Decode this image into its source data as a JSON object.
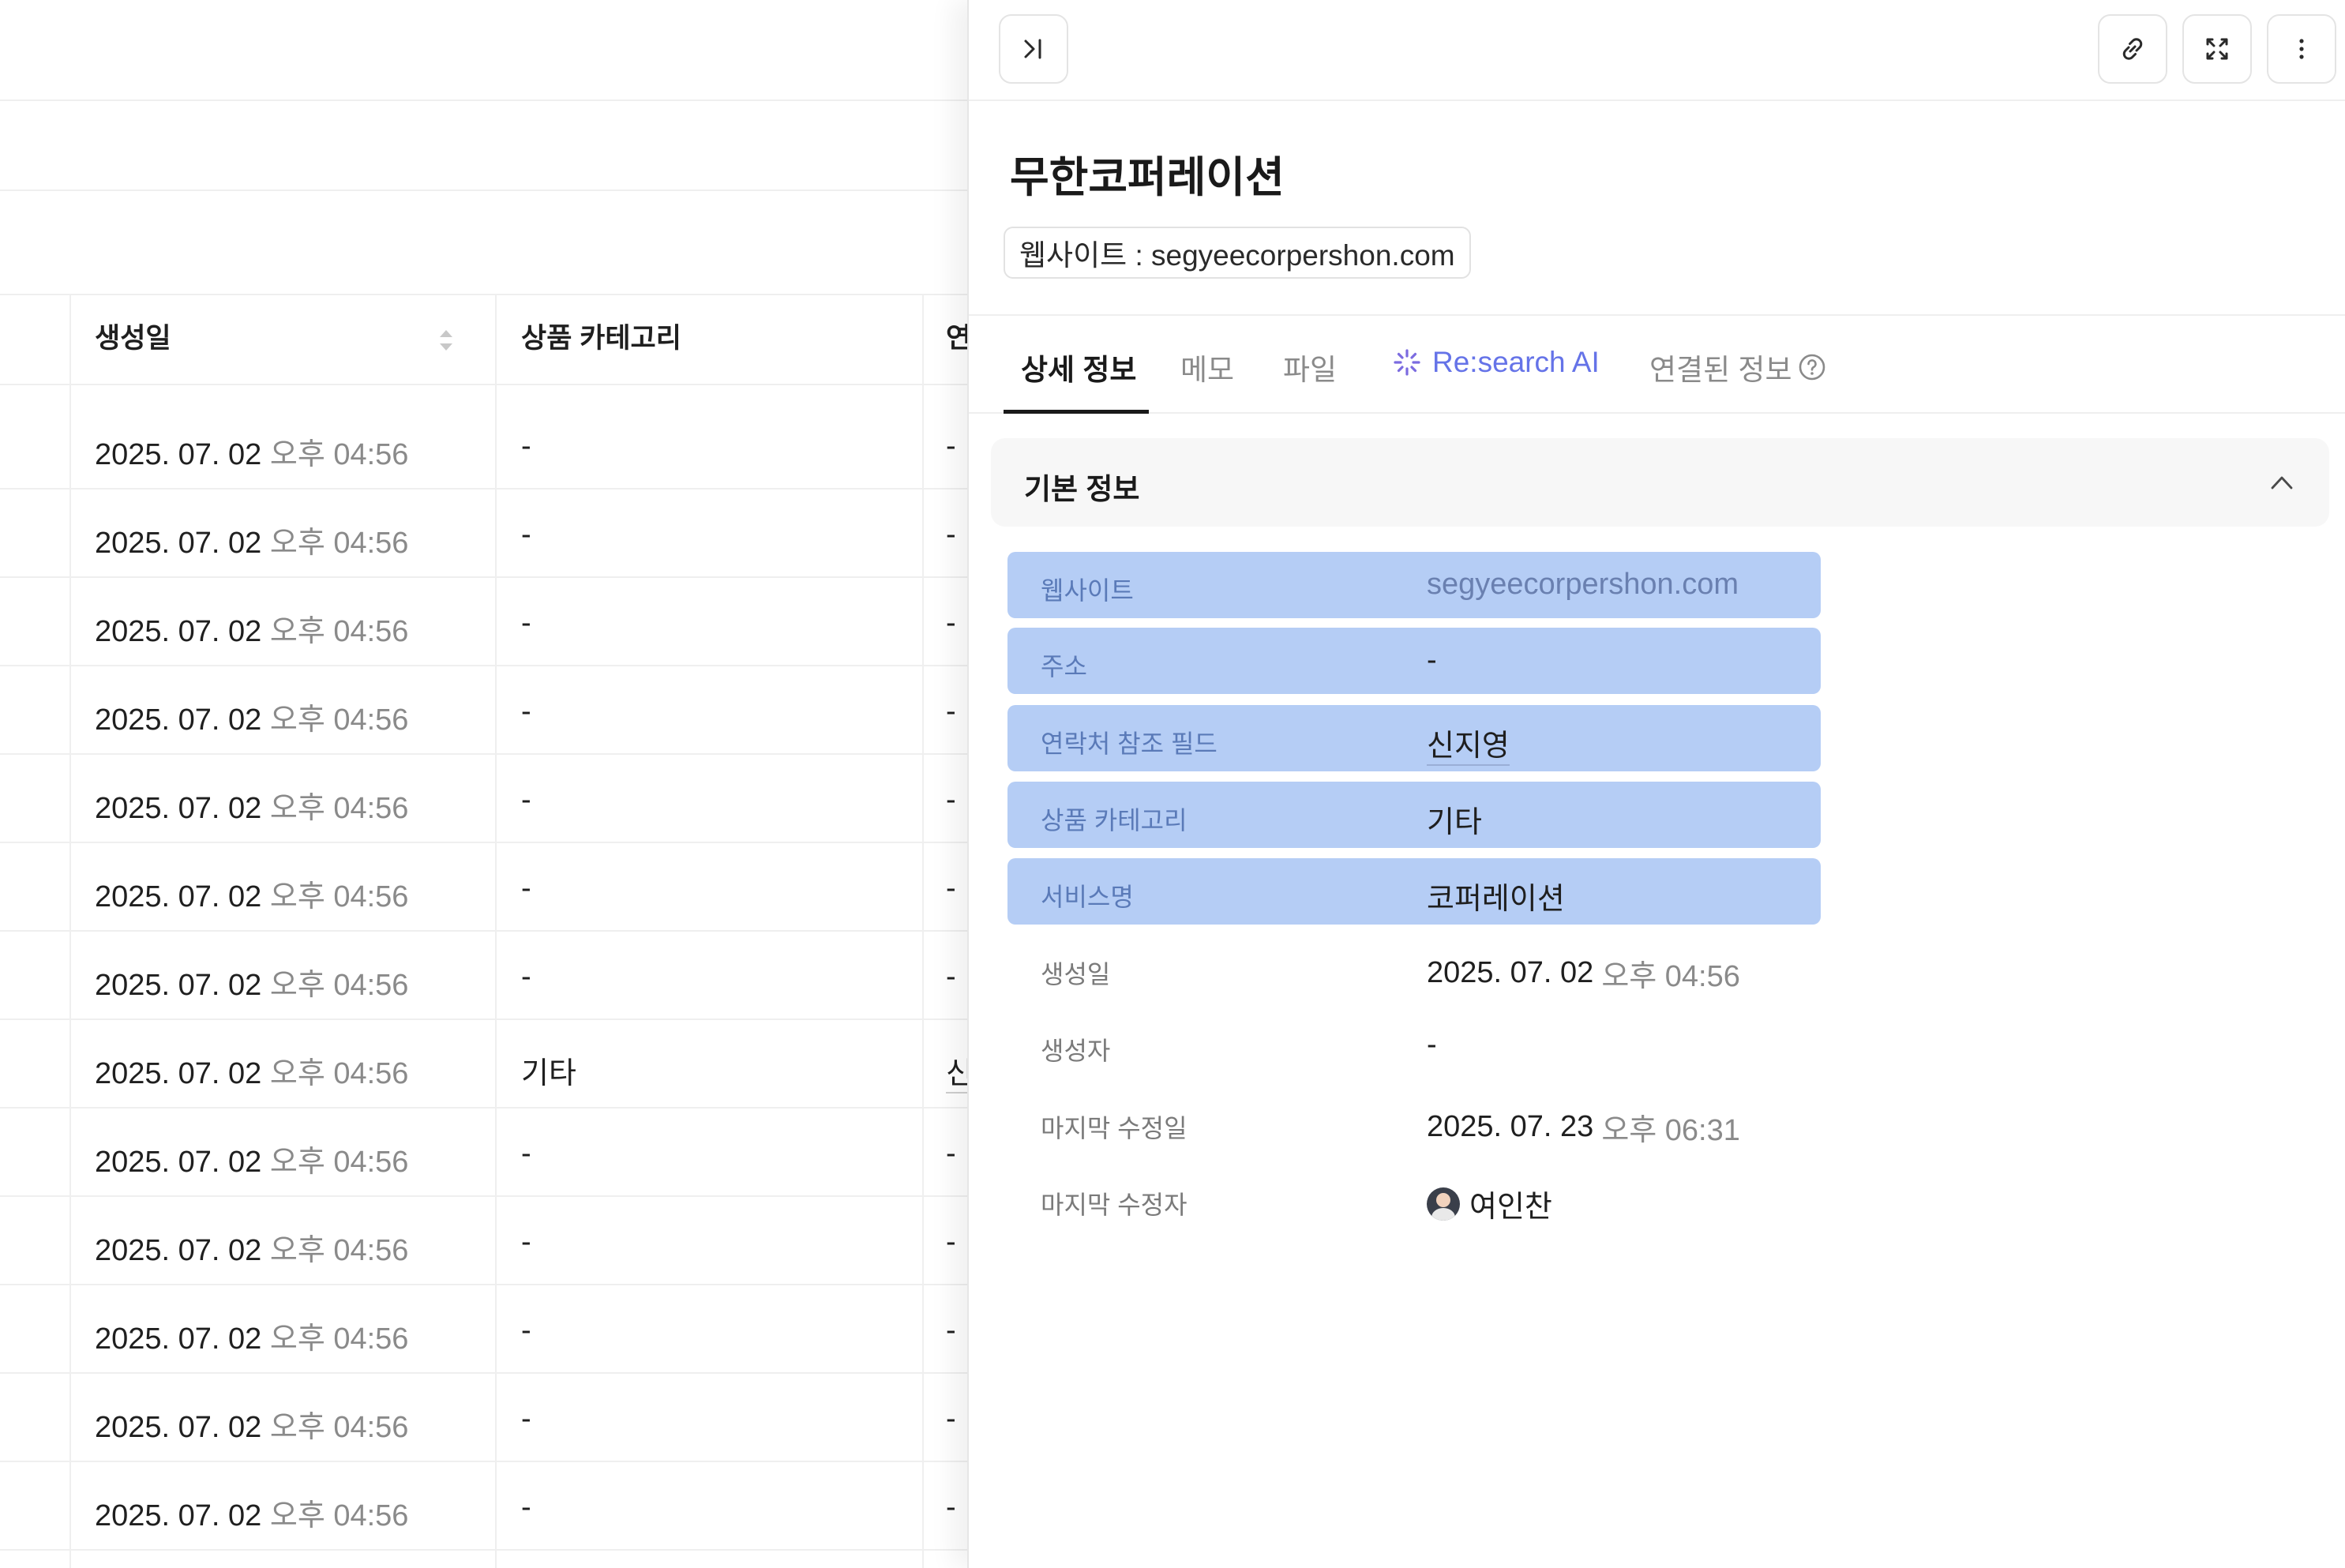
{
  "table": {
    "headers": {
      "created": "생성일",
      "category": "상품 카테고리",
      "third": "연"
    },
    "rows": [
      {
        "date": "2025. 07. 02",
        "time": "오후 04:56",
        "category": "-",
        "third": "-"
      },
      {
        "date": "2025. 07. 02",
        "time": "오후 04:56",
        "category": "-",
        "third": "-"
      },
      {
        "date": "2025. 07. 02",
        "time": "오후 04:56",
        "category": "-",
        "third": "-"
      },
      {
        "date": "2025. 07. 02",
        "time": "오후 04:56",
        "category": "-",
        "third": "-"
      },
      {
        "date": "2025. 07. 02",
        "time": "오후 04:56",
        "category": "-",
        "third": "-"
      },
      {
        "date": "2025. 07. 02",
        "time": "오후 04:56",
        "category": "-",
        "third": "-"
      },
      {
        "date": "2025. 07. 02",
        "time": "오후 04:56",
        "category": "-",
        "third": "-"
      },
      {
        "date": "2025. 07. 02",
        "time": "오후 04:56",
        "category": "기타",
        "third": "신"
      },
      {
        "date": "2025. 07. 02",
        "time": "오후 04:56",
        "category": "-",
        "third": "-"
      },
      {
        "date": "2025. 07. 02",
        "time": "오후 04:56",
        "category": "-",
        "third": "-"
      },
      {
        "date": "2025. 07. 02",
        "time": "오후 04:56",
        "category": "-",
        "third": "-"
      },
      {
        "date": "2025. 07. 02",
        "time": "오후 04:56",
        "category": "-",
        "third": "-"
      },
      {
        "date": "2025. 07. 02",
        "time": "오후 04:56",
        "category": "-",
        "third": "-"
      }
    ]
  },
  "panel": {
    "title": "무한코퍼레이션",
    "chip": "웹사이트 : segyeecorpershon.com",
    "tabs": {
      "detail": "상세 정보",
      "memo": "메모",
      "file": "파일",
      "ai": "Re:search AI",
      "linked": "연결된 정보"
    },
    "section_title": "기본 정보",
    "fields": {
      "website": {
        "label": "웹사이트",
        "value": "segyeecorpershon.com"
      },
      "address": {
        "label": "주소",
        "value": "-"
      },
      "contact_ref": {
        "label": "연락처 참조 필드",
        "value": "신지영"
      },
      "category": {
        "label": "상품 카테고리",
        "value": "기타"
      },
      "service": {
        "label": "서비스명",
        "value": "코퍼레이션"
      },
      "created": {
        "label": "생성일",
        "date": "2025. 07. 02",
        "time": "오후 04:56"
      },
      "creator": {
        "label": "생성자",
        "value": "-"
      },
      "modified": {
        "label": "마지막 수정일",
        "date": "2025. 07. 23",
        "time": "오후 06:31"
      },
      "modifier": {
        "label": "마지막 수정자",
        "value": "여인찬"
      }
    }
  },
  "colors": {
    "highlight": "#b5cdf5",
    "ai_accent": "#6573e8",
    "muted_text": "#8a8a8a"
  },
  "icons": [
    "collapse-panel-icon",
    "link-icon",
    "expand-icon",
    "more-vertical-icon",
    "sort-icon",
    "ai-sparkle-icon",
    "help-circle-icon",
    "chevron-up-icon",
    "avatar"
  ]
}
